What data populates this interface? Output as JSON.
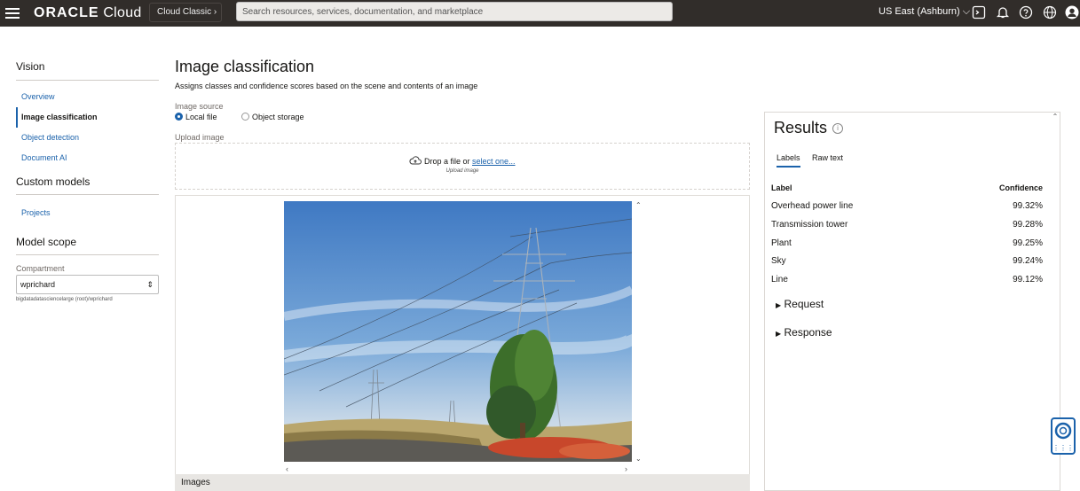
{
  "topbar": {
    "brand": "ORACLE",
    "brand_suffix": "Cloud",
    "classic_label": "Cloud Classic",
    "search_placeholder": "Search resources, services, documentation, and marketplace",
    "region": "US East (Ashburn)"
  },
  "sidebar": {
    "section_title": "Vision",
    "items": [
      "Overview",
      "Image classification",
      "Object detection",
      "Document AI"
    ],
    "custom_models_title": "Custom models",
    "custom_items": [
      "Projects"
    ],
    "model_scope_title": "Model scope",
    "compartment_label": "Compartment",
    "compartment_value": "wprichard",
    "compartment_path": "bigdatadatasciencelarge (root)/wprichard"
  },
  "main": {
    "title": "Image classification",
    "description": "Assigns classes and confidence scores based on the scene and contents of an image",
    "image_source_label": "Image source",
    "source_local": "Local file",
    "source_object": "Object storage",
    "upload_label": "Upload image",
    "drop_text": "Drop a file or",
    "select_link": "select one...",
    "drop_sub": "Upload image",
    "images_footer": "Images"
  },
  "results": {
    "title": "Results",
    "tabs": [
      "Labels",
      "Raw text"
    ],
    "col_label": "Label",
    "col_confidence": "Confidence",
    "rows": [
      {
        "label": "Overhead power line",
        "confidence": "99.32%"
      },
      {
        "label": "Transmission tower",
        "confidence": "99.28%"
      },
      {
        "label": "Plant",
        "confidence": "99.25%"
      },
      {
        "label": "Sky",
        "confidence": "99.24%"
      },
      {
        "label": "Line",
        "confidence": "99.12%"
      }
    ],
    "request_label": "Request",
    "response_label": "Response"
  },
  "colors": {
    "topbar": "#312d2a",
    "link": "#1b62ab"
  }
}
